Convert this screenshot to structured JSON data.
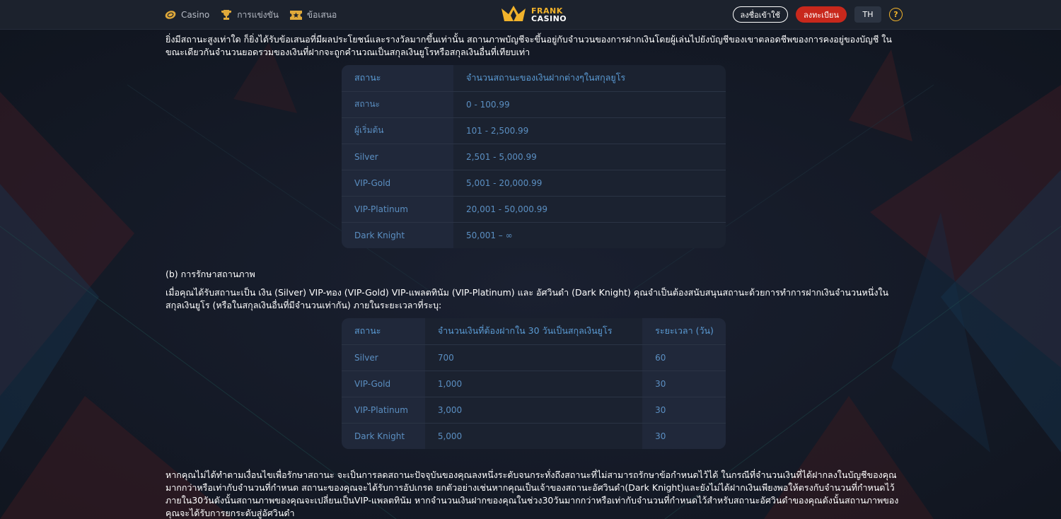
{
  "nav": {
    "casino": "Casino",
    "tournaments": "การแข่งขัน",
    "offers": "ข้อเสนอ"
  },
  "logo": {
    "line1": "FRANK",
    "line2": "CASINO"
  },
  "header": {
    "login_label": "ลงชื่อเข้าใช้",
    "register_label": "ลงทะเบียน",
    "lang_label": "TH",
    "help_label": "?"
  },
  "colors": {
    "accent": "#f2b32b",
    "register": "#c8281c",
    "table_text": "#5b8fc2"
  },
  "content": {
    "paragraph1": "ยิ่งมีสถานะสูงเท่าใด ก็ยิ่งได้รับข้อเสนอที่มีผลประโยชน์และรางวัลมากขึ้นเท่านั้น สถานภาพบัญชีจะขึ้นอยู่กับจำนวนของการฝากเงินโดยผู้เล่นไปยังบัญชีของเขาตลอดชีพของการคงอยู่ของบัญชี ในขณะเดียวกันจำนวนยอดรวมของเงินที่ฝากจะถูกคำนวณเป็นสกุลเงินยูโรหรือสกุลเงินอื่นที่เทียบเท่า",
    "status_table": {
      "header": [
        "สถานะ",
        "จำนวนสถานะของเงินฝากต่างๆในสกุลยูโร"
      ],
      "rows": [
        [
          "สถานะ",
          "0 - 100.99"
        ],
        [
          "ผู้เริ่มต้น",
          "101 - 2,500.99"
        ],
        [
          "Silver",
          "2,501 - 5,000.99"
        ],
        [
          "VIP-Gold",
          "5,001 - 20,000.99"
        ],
        [
          "VIP-Platinum",
          "20,001 - 50,000.99"
        ],
        [
          "Dark Knight",
          "50,001 – ∞"
        ]
      ]
    },
    "subheading": "(b) การรักษาสถานภาพ",
    "paragraph2": "เมื่อคุณได้รับสถานะเป็น เงิน (Silver) VIP-ทอง (VIP-Gold) VIP-แพลตทินัม (VIP-Platinum) และ อัศวินดำ (Dark Knight) คุณจำเป็นต้องสนับสนุนสถานะด้วยการทำการฝากเงินจำนวนหนึ่งในสกุลเงินยูโร (หรือในสกุลเงินอื่นที่มีจำนวนเท่ากัน) ภายในระยะเวลาที่ระบุ:",
    "maintain_table": {
      "header": [
        "สถานะ",
        "จำนวนเงินที่ต้องฝากใน 30 วันเป็นสกุลเงินยูโร",
        "ระยะเวลา (วัน)"
      ],
      "rows": [
        [
          "Silver",
          "700",
          "60"
        ],
        [
          "VIP-Gold",
          "1,000",
          "30"
        ],
        [
          "VIP-Platinum",
          "3,000",
          "30"
        ],
        [
          "Dark Knight",
          "5,000",
          "30"
        ]
      ]
    },
    "paragraph3": "หากคุณไม่ได้ทำตามเงื่อนไขเพื่อรักษาสถานะ จะเป็นการลดสถานะปัจจุบันของคุณลงหนึ่งระดับจนกระทั่งถึงสถานะที่ไม่สามารถรักษาข้อกำหนดไว้ได้ ในกรณีที่จำนวนเงินที่ได้ฝากลงในบัญชีของคุณมากกว่าหรือเท่ากับจำนวนที่กำหนด สถานะของคุณจะได้รับการอัปเกรด ยกตัวอย่างเช่นหากคุณเป็นเจ้าของสถานะอัศวินดำ(Dark Knight)และยังไม่ได้ฝากเงินเพียงพอให้ตรงกับจำนวนที่กำหนดไว้ภายใน30วันดังนั้นสถานภาพของคุณจะเปลี่ยนเป็นVIP-แพลตทินัม หากจำนวนเงินฝากของคุณในช่วง30วันมากกว่าหรือเท่ากับจำนวนที่กำหนดไว้สำหรับสถานะอัศวินดำของคุณดังนั้นสถานภาพของคุณจะได้รับการยกระดับสู่อัศวินดำ"
  }
}
